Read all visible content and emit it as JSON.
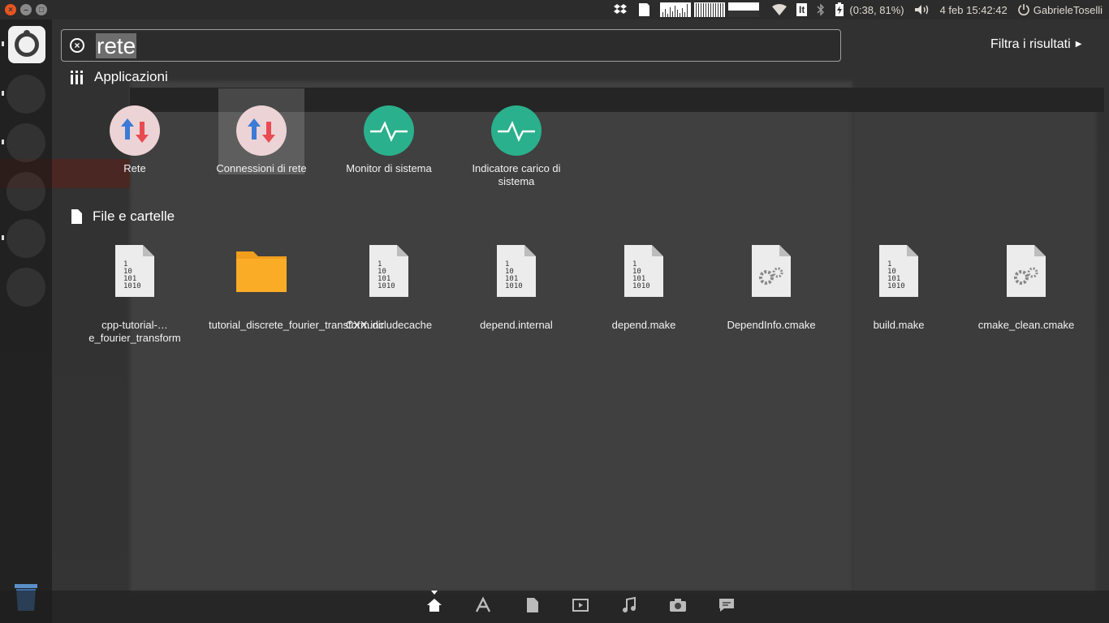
{
  "panel": {
    "dropbox_icon": "dropbox-icon",
    "battery": "(0:38, 81%)",
    "keyboard": "It",
    "datetime": "4 feb 15:42:42",
    "user": "GabrieleToselli",
    "window_close": "×",
    "window_min": "–",
    "window_max": "□"
  },
  "search": {
    "query": "rete",
    "filter_label": "Filtra i risultati"
  },
  "categories": {
    "apps": "Applicazioni",
    "files": "File e cartelle"
  },
  "apps": [
    {
      "label": "Rete",
      "icon": "network-icon"
    },
    {
      "label": "Connessioni di rete",
      "icon": "network-connections-icon"
    },
    {
      "label": "Monitor di sistema",
      "icon": "system-monitor-icon"
    },
    {
      "label": "Indicatore carico di sistema",
      "icon": "system-load-icon"
    }
  ],
  "files": [
    {
      "label": "cpp-tutorial-…e_fourier_transform",
      "icon": "binary-file-icon"
    },
    {
      "label": "tutorial_discrete_fourier_transform.dir",
      "icon": "folder-icon"
    },
    {
      "label": "CXX.includecache",
      "icon": "binary-file-icon"
    },
    {
      "label": "depend.internal",
      "icon": "binary-file-icon"
    },
    {
      "label": "depend.make",
      "icon": "binary-file-icon"
    },
    {
      "label": "DependInfo.cmake",
      "icon": "script-file-icon"
    },
    {
      "label": "build.make",
      "icon": "binary-file-icon"
    },
    {
      "label": "cmake_clean.cmake",
      "icon": "script-file-icon"
    }
  ],
  "dock_lenses": [
    "home-lens-icon",
    "applications-lens-icon",
    "files-lens-icon",
    "video-lens-icon",
    "music-lens-icon",
    "photos-lens-icon",
    "social-lens-icon"
  ]
}
